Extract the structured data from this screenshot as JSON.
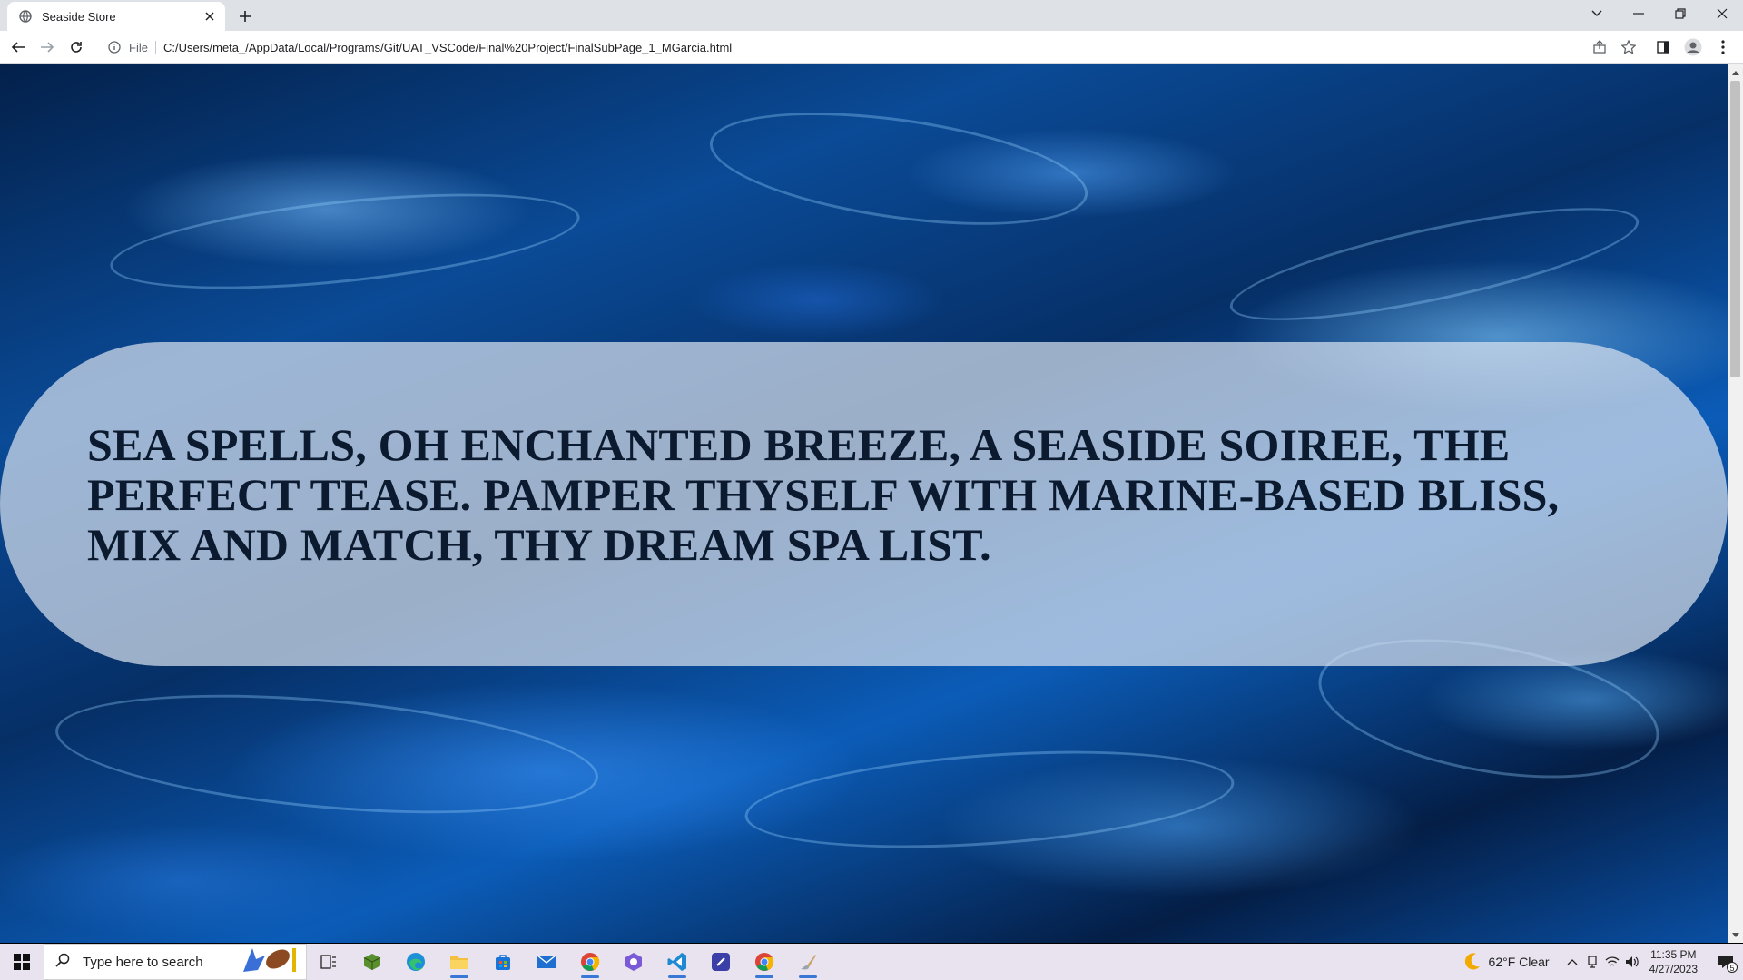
{
  "browser": {
    "tab_title": "Seaside Store",
    "url_scheme": "File",
    "url": "C:/Users/meta_/AppData/Local/Programs/Git/UAT_VSCode/Final%20Project/FinalSubPage_1_MGarcia.html"
  },
  "page": {
    "banner_text": "SEA SPELLS, OH ENCHANTED BREEZE, A SEASIDE SOIREE, THE PERFECT TEASE. PAMPER THYSELF WITH MARINE-BASED BLISS, MIX AND MATCH, THY DREAM SPA LIST."
  },
  "taskbar": {
    "search_placeholder": "Type here to search",
    "weather": "62°F  Clear",
    "time": "11:35 PM",
    "date": "4/27/2023",
    "notification_count": "5"
  },
  "colors": {
    "banner_bg": "#d7e1ee",
    "banner_text": "#0b1a2e",
    "taskbar_bg": "#e8e3ef"
  }
}
